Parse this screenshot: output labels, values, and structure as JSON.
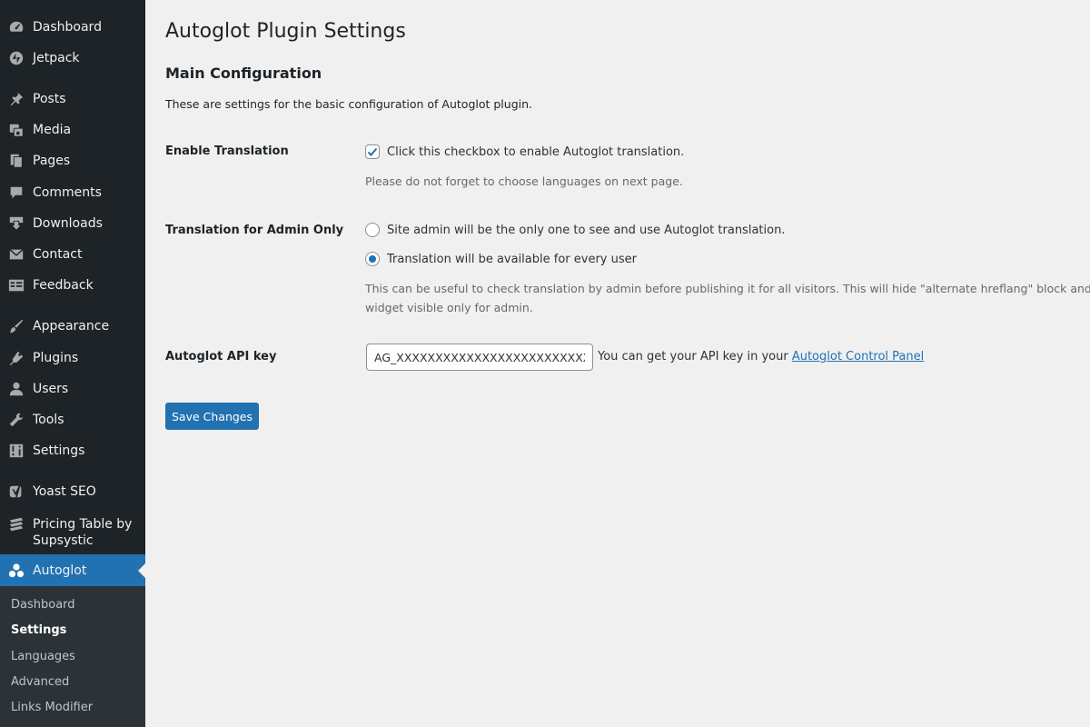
{
  "sidebar": {
    "items": [
      {
        "label": "Dashboard",
        "icon": "dashboard-icon"
      },
      {
        "label": "Jetpack",
        "icon": "jetpack-icon"
      },
      {
        "label": "Posts",
        "icon": "pin-icon"
      },
      {
        "label": "Media",
        "icon": "media-icon"
      },
      {
        "label": "Pages",
        "icon": "pages-icon"
      },
      {
        "label": "Comments",
        "icon": "comment-icon"
      },
      {
        "label": "Downloads",
        "icon": "download-icon"
      },
      {
        "label": "Contact",
        "icon": "mail-icon"
      },
      {
        "label": "Feedback",
        "icon": "feedback-icon"
      },
      {
        "label": "Appearance",
        "icon": "brush-icon"
      },
      {
        "label": "Plugins",
        "icon": "plugin-icon"
      },
      {
        "label": "Users",
        "icon": "user-icon"
      },
      {
        "label": "Tools",
        "icon": "wrench-icon"
      },
      {
        "label": "Settings",
        "icon": "sliders-icon"
      },
      {
        "label": "Yoast SEO",
        "icon": "yoast-icon"
      },
      {
        "label": "Pricing Table by",
        "label2": "Supsystic",
        "icon": "table-icon"
      },
      {
        "label": "Autoglot",
        "icon": "autoglot-icon",
        "current": true
      }
    ],
    "submenu": [
      {
        "label": "Dashboard"
      },
      {
        "label": "Settings",
        "active": true
      },
      {
        "label": "Languages"
      },
      {
        "label": "Advanced"
      },
      {
        "label": "Links Modifier"
      }
    ]
  },
  "main": {
    "title": "Autoglot Plugin Settings",
    "section_title": "Main Configuration",
    "section_desc": "These are settings for the basic configuration of Autoglot plugin.",
    "enable": {
      "label": "Enable Translation",
      "checkbox_label": "Click this checkbox to enable Autoglot translation.",
      "checked": true,
      "hint": "Please do not forget to choose languages on next page."
    },
    "admin_only": {
      "label": "Translation for Admin Only",
      "options": [
        {
          "label": "Site admin will be the only one to see and use Autoglot translation.",
          "selected": false
        },
        {
          "label": "Translation will be available for every user",
          "selected": true
        }
      ],
      "hint_line1": "This can be useful to check translation by admin before publishing it for all visitors. This will hide \"alternate hreflang\" block and will m",
      "hint_line2": "widget visible only for admin."
    },
    "api": {
      "label": "Autoglot API key",
      "value": "AG_XXXXXXXXXXXXXXXXXXXXXXXXXX",
      "note": "You can get your API key in your",
      "link": "Autoglot Control Panel"
    },
    "save_label": "Save Changes"
  },
  "colors": {
    "sidebar_bg": "#1d2327",
    "submenu_bg": "#2c3338",
    "accent": "#2271b1",
    "page_bg": "#f0f0f1"
  }
}
